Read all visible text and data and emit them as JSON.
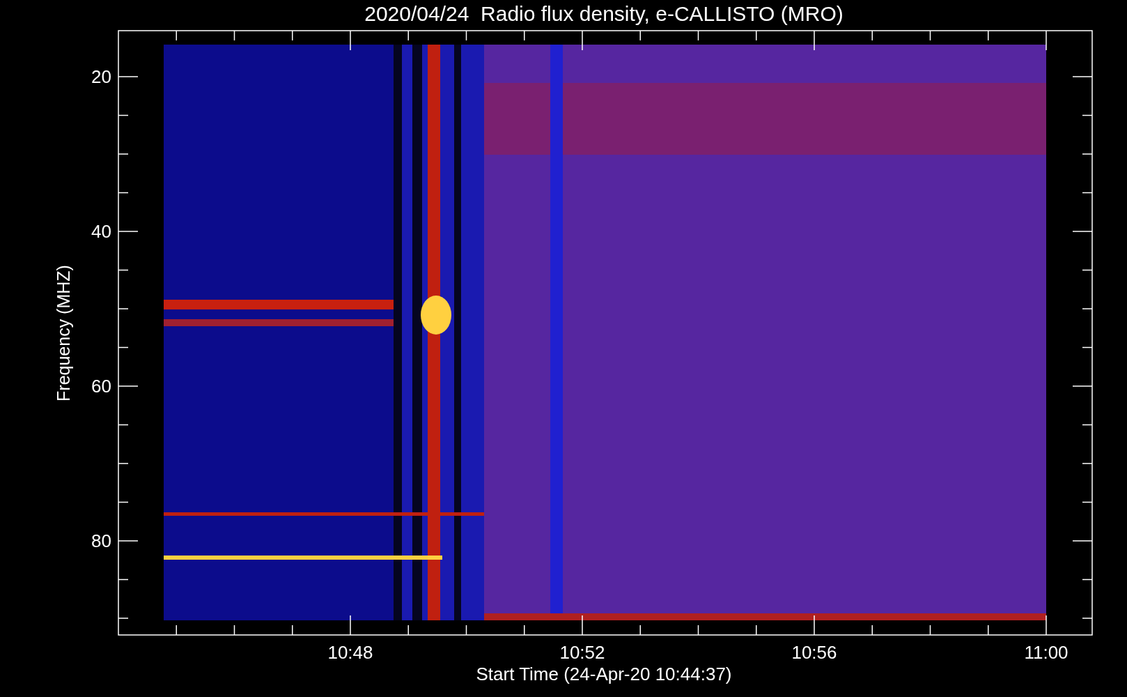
{
  "title": "2020/04/24  Radio flux density, e-CALLISTO (MRO)",
  "y_axis": {
    "label": "Frequency (MHZ)",
    "ticks": [
      "20",
      "40",
      "60",
      "80"
    ]
  },
  "x_axis": {
    "label": "Start Time (24-Apr-20 10:44:37)",
    "ticks": [
      "10:48",
      "10:52",
      "10:56",
      "11:00"
    ]
  }
}
